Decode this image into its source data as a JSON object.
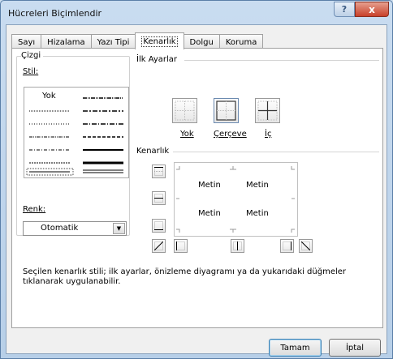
{
  "window": {
    "title": "Hücreleri Biçimlendir",
    "help_label": "?",
    "close_label": "x"
  },
  "tabs": [
    {
      "label": "Sayı"
    },
    {
      "label": "Hizalama"
    },
    {
      "label": "Yazı Tipi"
    },
    {
      "label": "Kenarlık"
    },
    {
      "label": "Dolgu"
    },
    {
      "label": "Koruma"
    }
  ],
  "line_group": {
    "title": "Çizgi",
    "style_label": "Stil:",
    "none_option": "Yok",
    "color_label": "Renk:",
    "color_value": "Otomatik"
  },
  "presets": {
    "title": "İlk Ayarlar",
    "none_label": "Yok",
    "outline_label": "Çerçeve",
    "inside_label": "İç"
  },
  "border": {
    "title": "Kenarlık",
    "preview_cells": [
      "Metin",
      "Metin",
      "Metin",
      "Metin"
    ]
  },
  "description": "Seçilen kenarlık stili; ilk ayarlar, önizleme diyagramı ya da yukarıdaki düğmeler tıklanarak uygulanabilir.",
  "buttons": {
    "ok": "Tamam",
    "cancel": "İptal"
  },
  "colors": {
    "title_bar": "#c9dcf0",
    "close_button": "#c8402a",
    "panel_bg": "#ffffff",
    "dialog_bg": "#f0f0f0"
  }
}
